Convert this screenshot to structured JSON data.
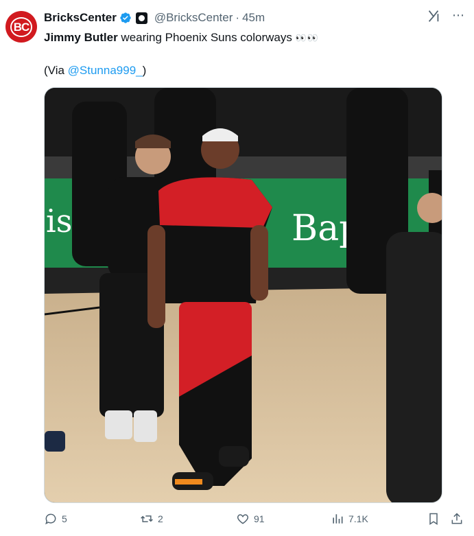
{
  "author": {
    "avatar_text": "BC",
    "name": "BricksCenter",
    "handle": "@BricksCenter",
    "separator": "·",
    "time": "45m"
  },
  "tweet": {
    "bold": "Jimmy Butler",
    "text": " wearing Phoenix Suns colorways",
    "emoji": "👀👀",
    "via_prefix": "(Via ",
    "via_handle": "@Stunna999_",
    "via_suffix": ")"
  },
  "media": {
    "banner_left": "ist",
    "banner_right": "Bap"
  },
  "actions": {
    "replies": "5",
    "reposts": "2",
    "likes": "91",
    "views": "7.1K"
  },
  "colors": {
    "brand_red": "#d11a1f",
    "link": "#1d9bf0",
    "muted": "#536471",
    "banner_green": "#1f8a4c"
  },
  "icons": [
    "verified-icon",
    "affiliate-badge-icon",
    "grok-icon",
    "more-icon",
    "reply-icon",
    "repost-icon",
    "like-icon",
    "views-icon",
    "bookmark-icon",
    "share-icon"
  ]
}
